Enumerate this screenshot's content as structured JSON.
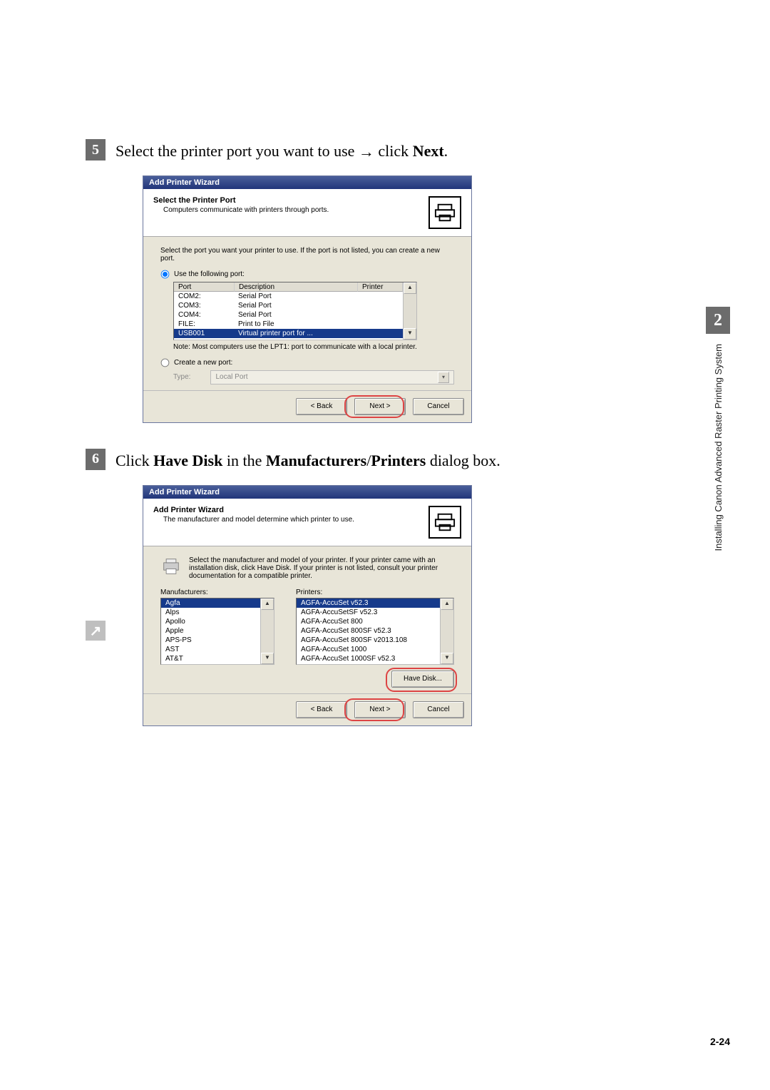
{
  "sidebar": {
    "chapter_number": "2",
    "title": "Installing Canon Advanced Raster Printing System"
  },
  "page_number": "2-24",
  "steps": {
    "5": {
      "num": "5",
      "pre": "Select the printer port you want to use ",
      "arrow": "→",
      "post": " click ",
      "bold": "Next",
      "tail": "."
    },
    "6": {
      "num": "6",
      "pre": "Click ",
      "b1": "Have Disk",
      "mid": " in the ",
      "b2": "Manufacturers",
      "slash": "/",
      "b3": "Printers",
      "tail": " dialog box."
    }
  },
  "dialog1": {
    "titlebar": "Add Printer Wizard",
    "header_title": "Select the Printer Port",
    "header_sub": "Computers communicate with printers through ports.",
    "body_intro": "Select the port you want your printer to use.  If the port is not listed, you can create a new port.",
    "radio_use": "Use the following port:",
    "port_headers": {
      "port": "Port",
      "desc": "Description",
      "printer": "Printer"
    },
    "port_rows": [
      {
        "port": "COM2:",
        "desc": "Serial Port",
        "printer": "",
        "sel": false
      },
      {
        "port": "COM3:",
        "desc": "Serial Port",
        "printer": "",
        "sel": false
      },
      {
        "port": "COM4:",
        "desc": "Serial Port",
        "printer": "",
        "sel": false
      },
      {
        "port": "FILE:",
        "desc": "Print to File",
        "printer": "",
        "sel": false
      },
      {
        "port": "USB001",
        "desc": "Virtual printer port for ...",
        "printer": "",
        "sel": true
      }
    ],
    "note": "Note: Most computers use the LPT1: port to communicate with a local printer.",
    "radio_new": "Create a new port:",
    "type_label": "Type:",
    "type_value": "Local Port",
    "buttons": {
      "back": "< Back",
      "next": "Next >",
      "cancel": "Cancel"
    }
  },
  "dialog2": {
    "titlebar": "Add Printer Wizard",
    "header_title": "Add Printer Wizard",
    "header_sub": "The manufacturer and model determine which printer to use.",
    "body_intro": "Select the manufacturer and model of your printer. If your printer came with an installation disk, click Have Disk. If your printer is not listed, consult your printer documentation for a compatible printer.",
    "manufacturers_label": "Manufacturers:",
    "printers_label": "Printers:",
    "manufacturers": [
      "Agfa",
      "Alps",
      "Apollo",
      "Apple",
      "APS-PS",
      "AST",
      "AT&T"
    ],
    "manufacturers_selected_index": 0,
    "printers": [
      "AGFA-AccuSet v52.3",
      "AGFA-AccuSetSF v52.3",
      "AGFA-AccuSet 800",
      "AGFA-AccuSet 800SF v52.3",
      "AGFA-AccuSet 800SF v2013.108",
      "AGFA-AccuSet 1000",
      "AGFA-AccuSet 1000SF v52.3"
    ],
    "printers_selected_index": 0,
    "have_disk": "Have Disk...",
    "buttons": {
      "back": "< Back",
      "next": "Next >",
      "cancel": "Cancel"
    }
  }
}
